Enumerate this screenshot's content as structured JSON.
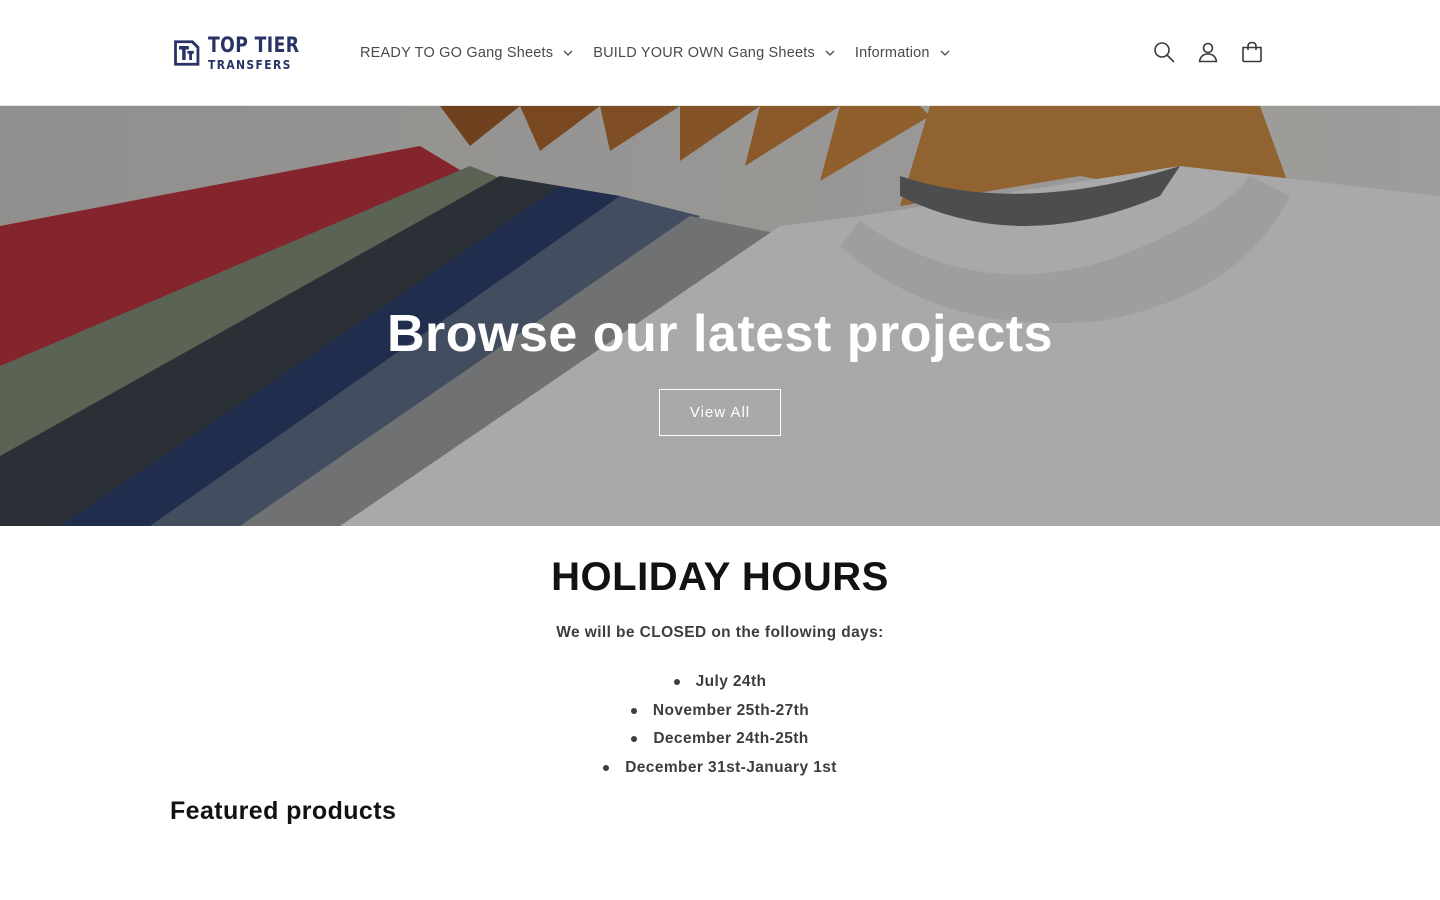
{
  "brand": {
    "name_top": "TOP TIER",
    "name_bottom": "TRANSFERS",
    "color": "#2a3366"
  },
  "nav": {
    "items": [
      {
        "label": "READY TO GO Gang Sheets",
        "icon": "chevron-down-icon"
      },
      {
        "label": "BUILD YOUR OWN Gang Sheets",
        "icon": "chevron-down-icon"
      },
      {
        "label": "Information",
        "icon": "chevron-down-icon"
      }
    ]
  },
  "header_icons": [
    "search-icon",
    "account-icon",
    "cart-icon"
  ],
  "hero": {
    "title": "Browse our latest projects",
    "button_label": "View All"
  },
  "holiday": {
    "title": "HOLIDAY HOURS",
    "subtitle": "We will be CLOSED on the following days:",
    "dates": [
      "July 24th",
      "November 25th-27th",
      "December 24th-25th",
      "December 31st-January 1st"
    ]
  },
  "featured": {
    "title": "Featured products"
  }
}
